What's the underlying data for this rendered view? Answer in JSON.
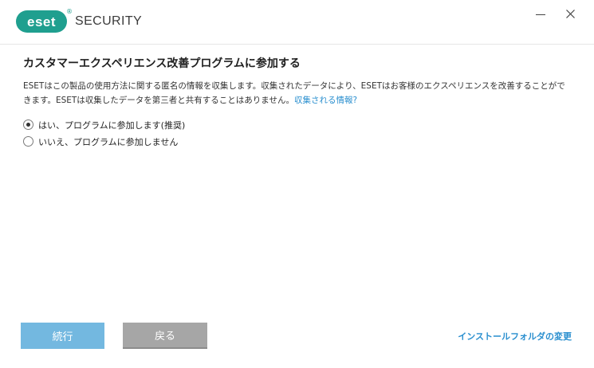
{
  "app": {
    "brand": "eset",
    "product": "SECURITY",
    "reg_mark": "®",
    "brand_color": "#1f9f8f"
  },
  "window_controls": {
    "minimize_icon": "minimize-icon",
    "close_icon": "close-icon",
    "close_glyph": "✕"
  },
  "page": {
    "title": "カスタマーエクスペリエンス改善プログラムに参加する",
    "description": "ESETはこの製品の使用方法に関する匿名の情報を収集します。収集されたデータにより、ESETはお客様のエクスペリエンスを改善することができます。ESETは収集したデータを第三者と共有することはありません。",
    "info_link": "収集される情報?",
    "link_color": "#2a8fcf"
  },
  "options": [
    {
      "label": "はい、プログラムに参加します(推奨)",
      "checked": true
    },
    {
      "label": "いいえ、プログラムに参加しません",
      "checked": false
    }
  ],
  "footer": {
    "continue_label": "続行",
    "back_label": "戻る",
    "folder_link": "インストールフォルダの変更",
    "continue_color": "#73b8e0",
    "back_color": "#a6a6a6"
  }
}
